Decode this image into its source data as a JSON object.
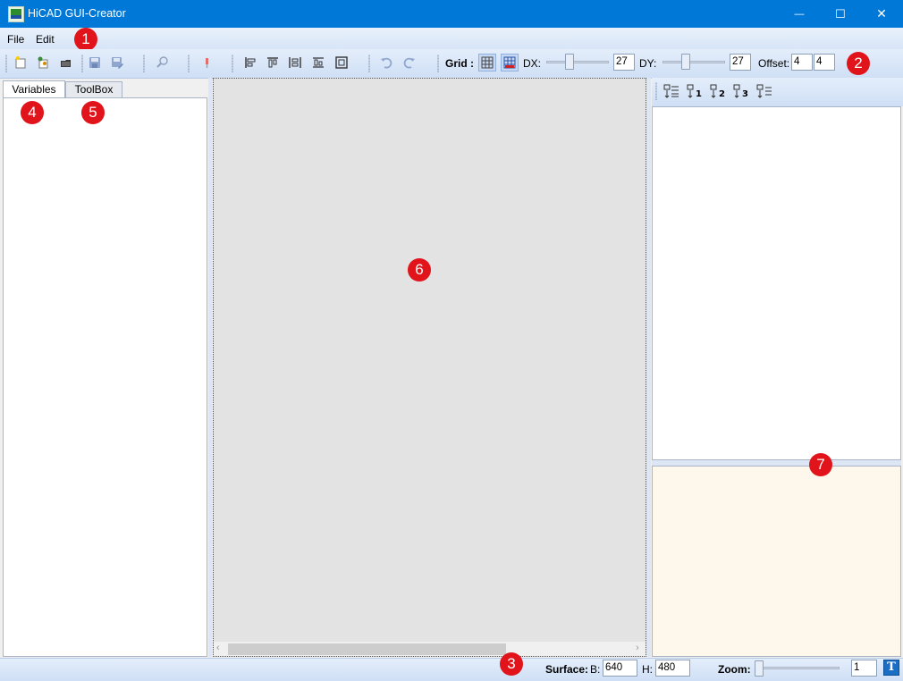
{
  "window": {
    "title": "HiCAD GUI-Creator",
    "minimize_glyph": "—",
    "maximize_glyph": "☐",
    "close_glyph": "✕"
  },
  "menu": {
    "file": "File",
    "edit": "Edit"
  },
  "toolbar": {
    "grid_label": "Grid :",
    "dx_label": "DX:",
    "dx_value": "27",
    "dy_label": "DY:",
    "dy_value": "27",
    "offset_label": "Offset:",
    "offset_x": "4",
    "offset_y": "4"
  },
  "left_panel": {
    "tabs": [
      "Variables",
      "ToolBox"
    ]
  },
  "status": {
    "surface_label": "Surface:",
    "b_label": "B:",
    "b_value": "640",
    "h_label": "H:",
    "h_value": "480",
    "zoom_label": "Zoom:",
    "zoom_value": "1",
    "text_icon_glyph": "T"
  },
  "callouts": [
    "1",
    "2",
    "3",
    "4",
    "5",
    "6",
    "7"
  ],
  "colors": {
    "titlebar": "#0078d7",
    "callout": "#e0141a",
    "canvas": "#e3e3e3",
    "description_bg": "#fef8ec"
  },
  "icons": {
    "toolbar": [
      "new-icon",
      "open-icon",
      "folder-icon",
      "save-icon",
      "save-as-icon",
      "preview-icon",
      "pin-icon",
      "align-left-icon",
      "align-top-icon",
      "align-width-icon",
      "align-bottom-icon",
      "center-icon",
      "undo-icon",
      "redo-icon",
      "grid-icon",
      "snap-grid-icon"
    ],
    "right_toolbar": [
      "sort-alpha-icon",
      "sort-1-icon",
      "sort-2-icon",
      "sort-3-icon",
      "sort-list-icon"
    ]
  }
}
